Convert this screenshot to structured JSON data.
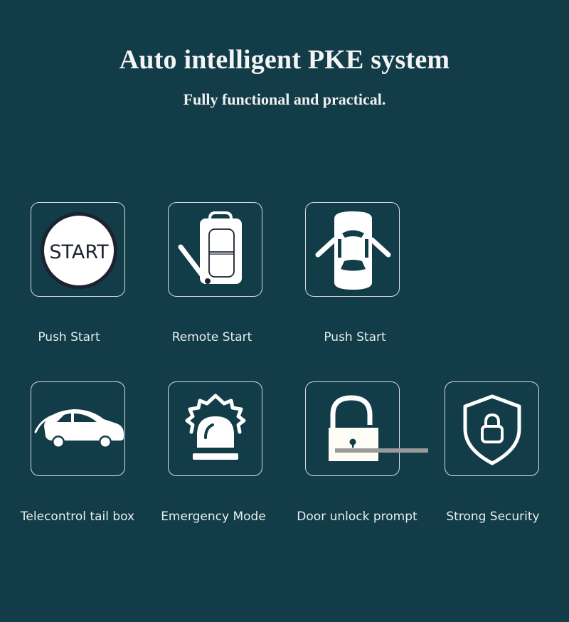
{
  "header": {
    "title": "Auto intelligent PKE system",
    "subtitle": "Fully functional and practical."
  },
  "colors": {
    "background": "#123c47",
    "icon_fill": "#ffffff",
    "box_border": "#d6dde0",
    "start_ring": "#1c2230",
    "overlay_bar": "#9a9a9a"
  },
  "features": [
    {
      "label": "Push Start",
      "icon": "start-button-icon",
      "icon_text": "START"
    },
    {
      "label": "Remote Start",
      "icon": "key-fob-icon"
    },
    {
      "label": "Push Start",
      "icon": "car-doors-open-icon"
    },
    {
      "label": "Telecontrol tail box",
      "icon": "car-trunk-icon"
    },
    {
      "label": "Emergency Mode",
      "icon": "siren-icon"
    },
    {
      "label": "Door unlock prompt",
      "icon": "padlock-icon"
    },
    {
      "label": "Strong Security",
      "icon": "shield-lock-icon"
    }
  ]
}
